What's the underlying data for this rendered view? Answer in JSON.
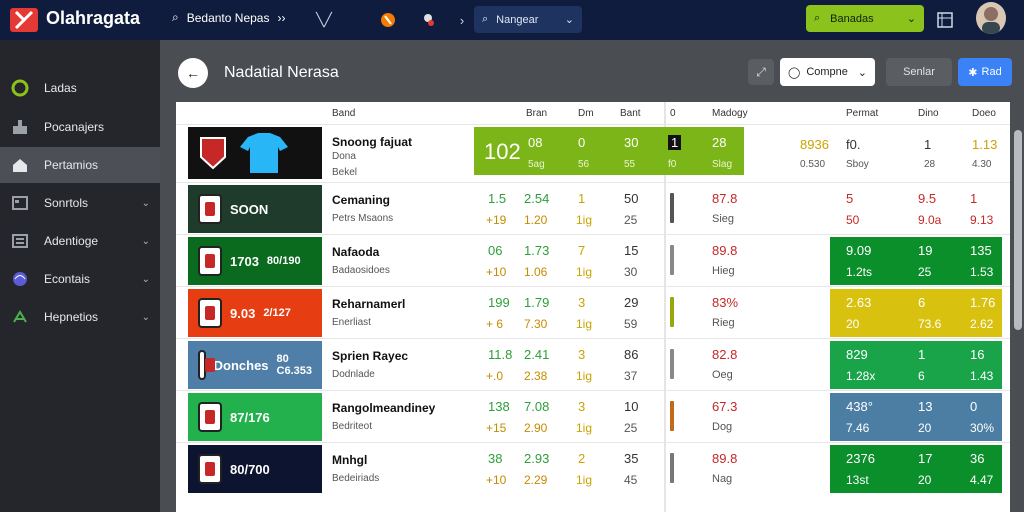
{
  "topbar": {
    "app_title": "Olahragata",
    "search_label": "Bedanto Nepas",
    "search2_placeholder": "Nangear",
    "green_btn_label": "Banadas",
    "accent": "#8bc21b",
    "bg": "#0f1c3d",
    "icons": [
      "search-icon",
      "compare-arrows-icon",
      "chart-icon",
      "fire-icon",
      "tool-icon",
      "chevron-icon",
      "search-icon",
      "chevron-down-icon",
      "search-icon",
      "chevron-down-icon",
      "grid-icon"
    ]
  },
  "sidebar": {
    "items": [
      {
        "label": "Ladas",
        "icon": "circle-icon",
        "active": false,
        "chevron": false
      },
      {
        "label": "Pocanajers",
        "icon": "tools-icon",
        "active": false,
        "chevron": false
      },
      {
        "label": "Pertamios",
        "icon": "home-icon",
        "active": true,
        "chevron": false
      },
      {
        "label": "Sonrtols",
        "icon": "window-icon",
        "active": false,
        "chevron": true
      },
      {
        "label": "Adentioge",
        "icon": "list-icon",
        "active": false,
        "chevron": true
      },
      {
        "label": "Econtais",
        "icon": "orb-icon",
        "active": false,
        "chevron": true
      },
      {
        "label": "Hepnetios",
        "icon": "scale-icon",
        "active": false,
        "chevron": true
      }
    ]
  },
  "page": {
    "title": "Nadatial Nerasa",
    "compare_label": "Compne",
    "export_label": "Senlar",
    "primary_label": "Rad"
  },
  "table": {
    "headers": [
      "Band",
      "Bran",
      "Dm",
      "Bant",
      "0",
      "Madogy",
      "Permat",
      "Dino",
      "Doeo"
    ],
    "rows": [
      {
        "thumb_text": "",
        "thumb_bg": "#111111",
        "name": "Snoong fajuat",
        "sub1": "Dona",
        "sub2": "Bekel",
        "mid_big": "102",
        "mid": [
          "08",
          "0",
          "30",
          "1",
          "28"
        ],
        "mid_sub": [
          "5ag",
          "56",
          "55",
          "f0",
          "Slag"
        ],
        "right": [
          "8936",
          "f0.",
          "1",
          "1.13"
        ],
        "right_sub": [
          "0.530",
          "Sboy",
          "28",
          "4.30"
        ],
        "bar_color": "#777777",
        "right_bg": "#ffffff",
        "right_color": "#333333"
      },
      {
        "thumb_text": "SOON",
        "thumb_bg": "#1f3b2b",
        "name": "Cemaning",
        "sub1": "Petrs Msaons",
        "sub2": "",
        "mid": [
          "1.5",
          "2.54",
          "1",
          "50"
        ],
        "mid_sub": [
          "+19",
          "1.20",
          "1ig",
          "25"
        ],
        "right": [
          "87.8",
          "5",
          "9.5",
          "1"
        ],
        "right_sub": [
          "Sieg",
          "50",
          "9.0a",
          "9.13"
        ],
        "bar_color": "#555555",
        "right_bg": "#ffffff",
        "right_color": "#c62828"
      },
      {
        "thumb_text": "1703",
        "thumb_text2": "80/190",
        "thumb_bg": "#0a6b1e",
        "name": "Nafaoda",
        "sub1": "Badaosidoes",
        "sub2": "",
        "mid": [
          "06",
          "1.73",
          "7",
          "15"
        ],
        "mid_sub": [
          "+10",
          "1.06",
          "1ig",
          "30"
        ],
        "right": [
          "89.8",
          "9.09",
          "19",
          "135"
        ],
        "right_sub": [
          "Hieg",
          "1.2ts",
          "25",
          "1.53"
        ],
        "bar_color": "#888888",
        "right_bg": "#0a8f2b",
        "right_color": "#ffffff"
      },
      {
        "thumb_text": "9.03",
        "thumb_text2": "2/127",
        "thumb_bg": "#e63d12",
        "name": "Reharnamerl",
        "sub1": "Enerliast",
        "sub2": "",
        "mid": [
          "199",
          "1.79",
          "3",
          "29"
        ],
        "mid_sub": [
          "+ 6",
          "7.30",
          "1ig",
          "59"
        ],
        "right": [
          "83%",
          "2.63",
          "6",
          "1.76"
        ],
        "right_sub": [
          "Rieg",
          "20",
          "73.6",
          "2.62"
        ],
        "bar_color": "#9aa60f",
        "right_bg": "#d9c10f",
        "right_color": "#ffffff"
      },
      {
        "thumb_text": "Donches",
        "thumb_text2": "80 C6.353",
        "thumb_bg": "#4f7fa8",
        "name": "Sprien Rayec",
        "sub1": "Dodnlade",
        "sub2": "",
        "mid": [
          "11.8",
          "2.41",
          "3",
          "86"
        ],
        "mid_sub": [
          "+.0",
          "2.38",
          "1ig",
          "37"
        ],
        "right": [
          "82.8",
          "829",
          "1",
          "16"
        ],
        "right_sub": [
          "Oeg",
          "1.28x",
          "6",
          "1.43"
        ],
        "bar_color": "#888888",
        "right_bg": "#19a44a",
        "right_color": "#ffffff"
      },
      {
        "thumb_text": "87/176",
        "thumb_text2": "",
        "thumb_bg": "#22b14c",
        "name": "Rangolmeandiney",
        "sub1": "Bedriteot",
        "sub2": "",
        "mid": [
          "138",
          "7.08",
          "3",
          "10"
        ],
        "mid_sub": [
          "+15",
          "2.90",
          "1ig",
          "25"
        ],
        "right": [
          "67.3",
          "438°",
          "13",
          "0"
        ],
        "right_sub": [
          "Dog",
          "7.46",
          "20",
          "30%"
        ],
        "bar_color": "#c06a1c",
        "right_bg": "#4c7ea4",
        "right_color": "#ffffff"
      },
      {
        "thumb_text": "80/700",
        "thumb_text2": "",
        "thumb_bg": "#0d1430",
        "name": "Mnhgl",
        "sub1": "Bedeiriads",
        "sub2": "",
        "mid": [
          "38",
          "2.93",
          "2",
          "35"
        ],
        "mid_sub": [
          "+10",
          "2.29",
          "1ig",
          "45"
        ],
        "right": [
          "89.8",
          "2376",
          "17",
          "36"
        ],
        "right_sub": [
          "Nag",
          "13st",
          "20",
          "4.47"
        ],
        "bar_color": "#777777",
        "right_bg": "#0a8f2b",
        "right_color": "#ffffff"
      }
    ]
  }
}
